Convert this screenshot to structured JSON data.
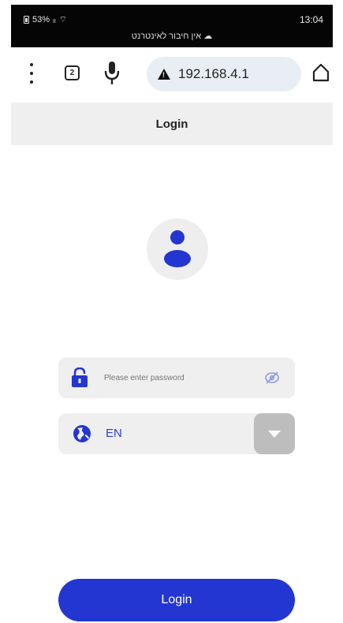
{
  "status_bar": {
    "left_text": "53%",
    "connection_text": "אין חיבור לאינטרנט",
    "time": "13:04"
  },
  "browser": {
    "tab_count": "2",
    "url": "192.168.4.1",
    "icons": [
      "menu-kebab-icon",
      "tabs-icon",
      "mic-icon",
      "warning-icon",
      "home-icon"
    ]
  },
  "page": {
    "title": "Login"
  },
  "form": {
    "password_placeholder": "Please enter password",
    "password_value": "",
    "language_value": "EN",
    "login_label": "Login"
  },
  "colors": {
    "accent": "#2336d1",
    "field_bg": "#efefef",
    "header_bg": "#efefef",
    "dropdown_bg": "#bdbdbd"
  }
}
